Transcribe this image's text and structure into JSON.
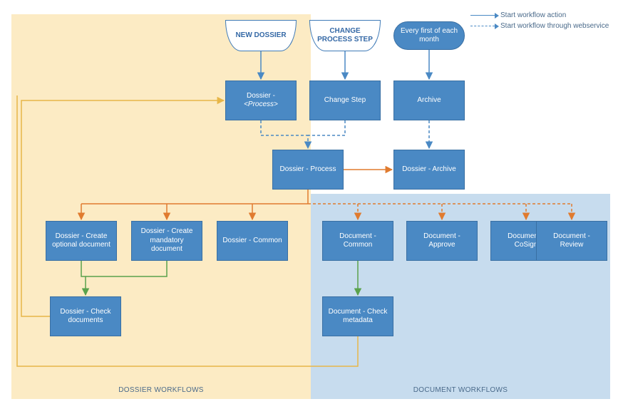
{
  "regions": {
    "dossier_label": "DOSSIER WORKFLOWS",
    "document_label": "DOCUMENT WORKFLOWS"
  },
  "legend": {
    "solid": "Start workflow action",
    "dashed": "Start workflow through webservice"
  },
  "triggers": {
    "new_dossier": "NEW DOSSIER",
    "change_step": "CHANGE PROCESS STEP",
    "schedule": "Every first of each month"
  },
  "nodes": {
    "dossier_process_tpl": "Dossier - <Process>",
    "change_step_box": "Change Step",
    "archive_box": "Archive",
    "dossier_process": "Dossier - Process",
    "dossier_archive": "Dossier - Archive",
    "create_optional": "Dossier - Create optional document",
    "create_mandatory": "Dossier - Create mandatory document",
    "dossier_common": "Dossier - Common",
    "check_documents": "Dossier - Check documents",
    "doc_common": "Document - Common",
    "doc_approve": "Document - Approve",
    "doc_cosign": "Document - CoSign",
    "doc_review": "Document - Review",
    "doc_check_meta": "Document - Check metadata"
  },
  "colors": {
    "arrow_blue": "#4A89C4",
    "arrow_orange": "#E07B2F",
    "arrow_gold": "#E7B648",
    "arrow_green": "#5AA24C"
  }
}
